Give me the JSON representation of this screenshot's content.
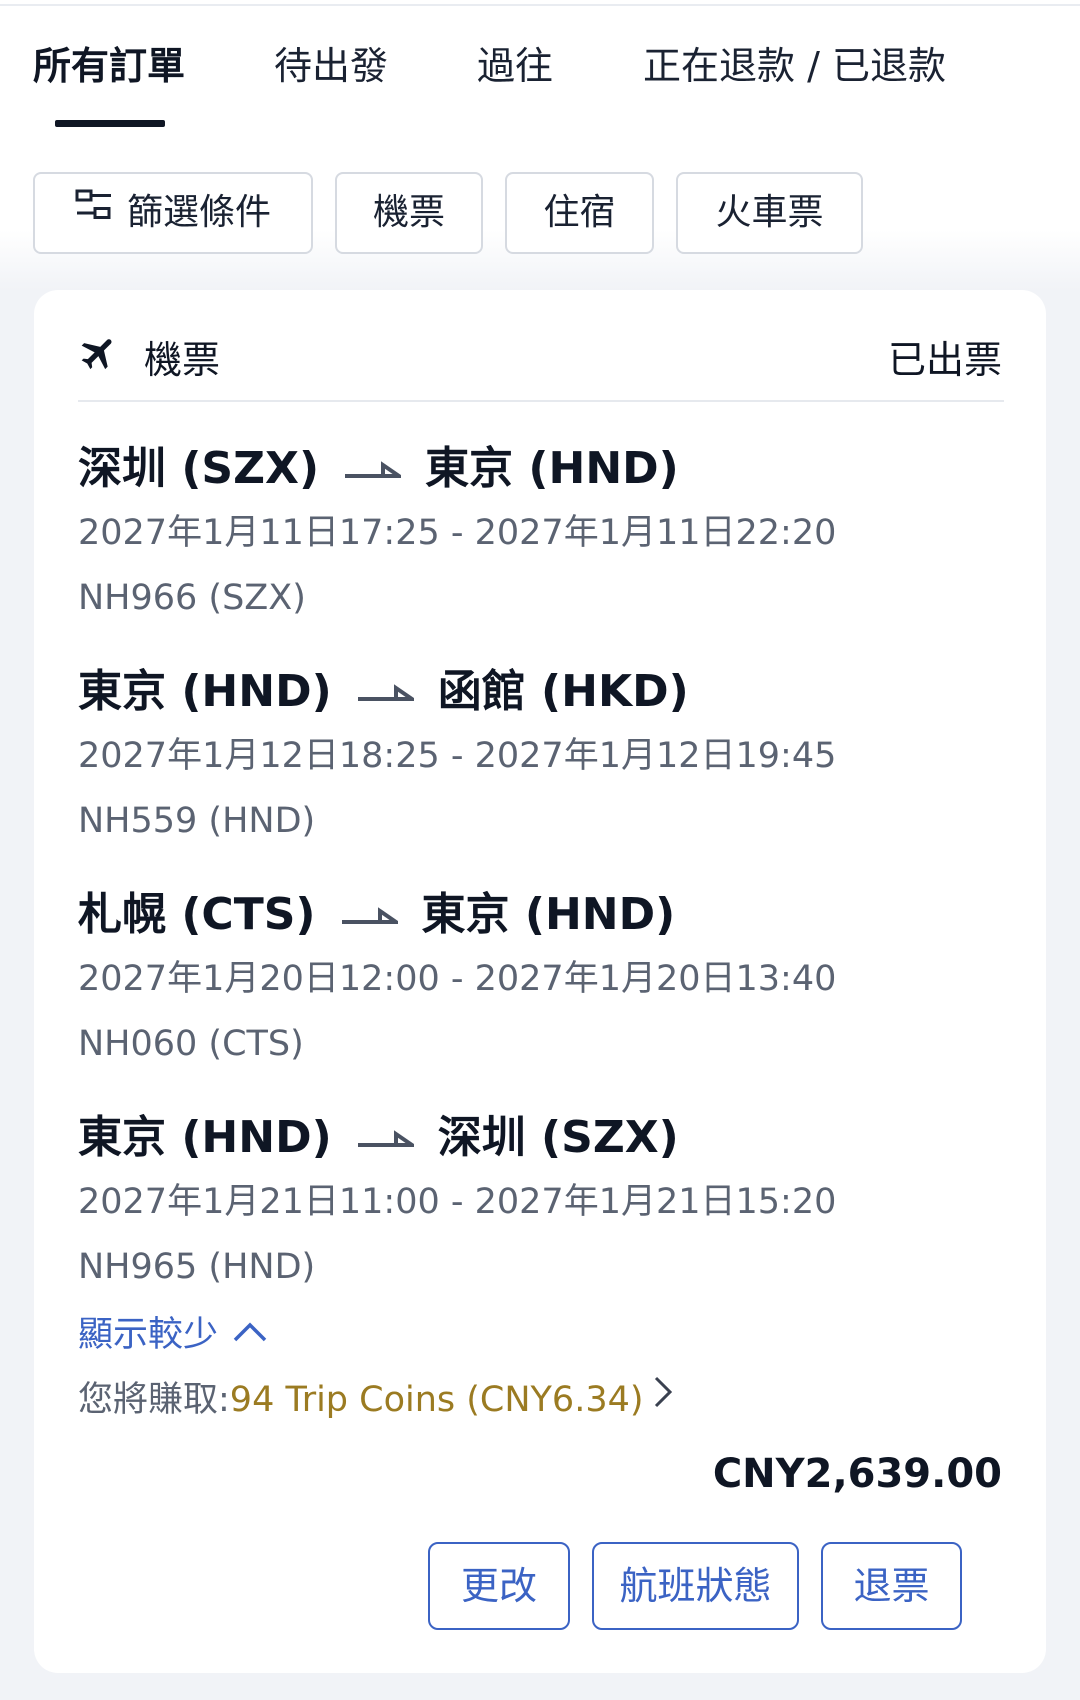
{
  "tabs": [
    {
      "label": "所有訂單",
      "active": true
    },
    {
      "label": "待出發",
      "active": false
    },
    {
      "label": "過往",
      "active": false
    },
    {
      "label": "正在退款 / 已退款",
      "active": false
    }
  ],
  "filters": {
    "conditions_label": "篩選條件",
    "flights_label": "機票",
    "hotels_label": "住宿",
    "trains_label": "火車票"
  },
  "order": {
    "type_label": "機票",
    "status": "已出票",
    "segments": [
      {
        "from": "深圳 (SZX)",
        "to": "東京 (HND)",
        "time": "2027年1月11日17:25 - 2027年1月11日22:20",
        "flight": "NH966 (SZX)"
      },
      {
        "from": "東京 (HND)",
        "to": "函館 (HKD)",
        "time": "2027年1月12日18:25 - 2027年1月12日19:45",
        "flight": "NH559 (HND)"
      },
      {
        "from": "札幌 (CTS)",
        "to": "東京 (HND)",
        "time": "2027年1月20日12:00 - 2027年1月20日13:40",
        "flight": "NH060 (CTS)"
      },
      {
        "from": "東京 (HND)",
        "to": "深圳 (SZX)",
        "time": "2027年1月21日11:00 - 2027年1月21日15:20",
        "flight": "NH965 (HND)"
      }
    ],
    "show_less_label": "顯示較少",
    "earn_label": "您將賺取:",
    "earn_value": "94 Trip Coins (CNY6.34)",
    "price": "CNY2,639.00",
    "actions": {
      "change_label": "更改",
      "flight_status_label": "航班狀態",
      "refund_label": "退票"
    }
  },
  "colors": {
    "accent": "#3b63c4",
    "coins": "#9b7b22",
    "text_primary": "#0f1624",
    "text_secondary": "#5b6372",
    "background": "#f1f3f7"
  }
}
